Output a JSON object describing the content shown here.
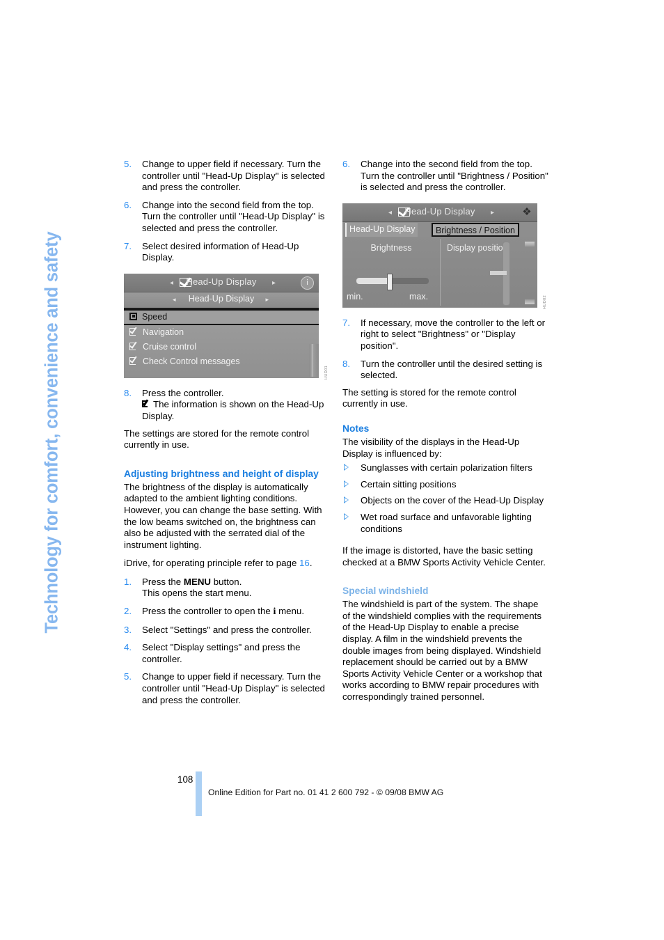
{
  "chapter_tab": {
    "label": "Technology for comfort, convenience and safety",
    "color": "#86b7ef"
  },
  "colors": {
    "accent_blue": "#1a7ee0",
    "light_blue": "#7cb3e8",
    "number_blue": "#2b8cf0",
    "footer_bar": "#abd0f4"
  },
  "left_column": {
    "steps_top": [
      {
        "num": "5.",
        "text": "Change to upper field if necessary. Turn the controller until \"Head-Up Display\" is selected and press the controller."
      },
      {
        "num": "6.",
        "text": "Change into the second field from the top. Turn the controller until \"Head-Up Display\" is selected and press the controller."
      },
      {
        "num": "7.",
        "text": "Select desired information of Head-Up Display."
      }
    ],
    "figure": {
      "header_title": "Head-Up Display",
      "header_arrow_left": "◂",
      "header_arrow_right": "▸",
      "info_icon_label": "i",
      "sub_title": "Head-Up Display",
      "sub_arrow_left": "◂",
      "sub_arrow_right": "▸",
      "rows": [
        {
          "label": "Speed",
          "state": "selected-box"
        },
        {
          "label": "Navigation",
          "state": "checked"
        },
        {
          "label": "Cruise control",
          "state": "checked"
        },
        {
          "label": "Check Control messages",
          "state": "checked"
        }
      ],
      "code": "HUD01"
    },
    "step_8": {
      "num": "8.",
      "line1": "Press the controller.",
      "line2": "The information is shown on the Head-Up Display."
    },
    "para_stored": "The settings are stored for the remote control currently in use.",
    "heading_adjust": "Adjusting brightness and height of display",
    "para_brightness": "The brightness of the display is automatically adapted to the ambient lighting conditions. However, you can change the base setting. With the low beams switched on, the brightness can also be adjusted with the serrated dial of the instrument lighting.",
    "para_idrive_pre": "iDrive, for operating principle refer to page ",
    "para_idrive_page": "16",
    "para_idrive_post": ".",
    "steps_bottom": [
      {
        "num": "1.",
        "pre": "Press the ",
        "bold": "MENU",
        "post": " button.",
        "second_line": "This opens the start menu."
      },
      {
        "num": "2.",
        "pre": "Press the controller to open the ",
        "icon": "i",
        "post": " menu."
      },
      {
        "num": "3.",
        "text": "Select \"Settings\" and press the controller."
      },
      {
        "num": "4.",
        "text": "Select \"Display settings\" and press the controller."
      },
      {
        "num": "5.",
        "text": "Change to upper field if necessary. Turn the controller until \"Head-Up Display\" is selected and press the controller."
      }
    ]
  },
  "right_column": {
    "step_6": {
      "num": "6.",
      "text": "Change into the second field from the top. Turn the controller until \"Brightness / Position\" is selected and press the controller."
    },
    "figure": {
      "header_title": "Head-Up Display",
      "header_arrow_left": "◂",
      "header_arrow_right": "▸",
      "cursor_icon": "❖",
      "tab_left": "Head-Up Display",
      "tab_right": "Brightness / Position",
      "label_brightness": "Brightness",
      "label_display_position": "Display position",
      "label_min": "min.",
      "label_max": "max.",
      "code": "HUD02"
    },
    "steps_after": [
      {
        "num": "7.",
        "text": "If necessary, move the controller to the left or right to select \"Brightness\" or \"Display position\"."
      },
      {
        "num": "8.",
        "text": "Turn the controller until the desired setting is selected."
      }
    ],
    "para_stored": "The setting is stored for the remote control currently in use.",
    "heading_notes": "Notes",
    "para_visibility": "The visibility of the displays in the Head-Up Display is influenced by:",
    "bullets": [
      "Sunglasses with certain polarization filters",
      "Certain sitting positions",
      "Objects on the cover of the Head-Up Display",
      "Wet road surface and unfavorable lighting conditions"
    ],
    "para_distorted": "If the image is distorted, have the basic setting checked at a BMW Sports Activity Vehicle Center.",
    "heading_windshield": "Special windshield",
    "para_windshield": "The windshield is part of the system. The shape of the windshield complies with the requirements of the Head-Up Display to enable a precise display. A film in the windshield prevents the double images from being displayed. Windshield replacement should be carried out by a BMW Sports Activity Vehicle Center or a workshop that works according to BMW repair procedures with correspondingly trained personnel."
  },
  "footer": {
    "page_number": "108",
    "note": "Online Edition for Part no. 01 41 2 600 792 - © 09/08 BMW AG"
  }
}
